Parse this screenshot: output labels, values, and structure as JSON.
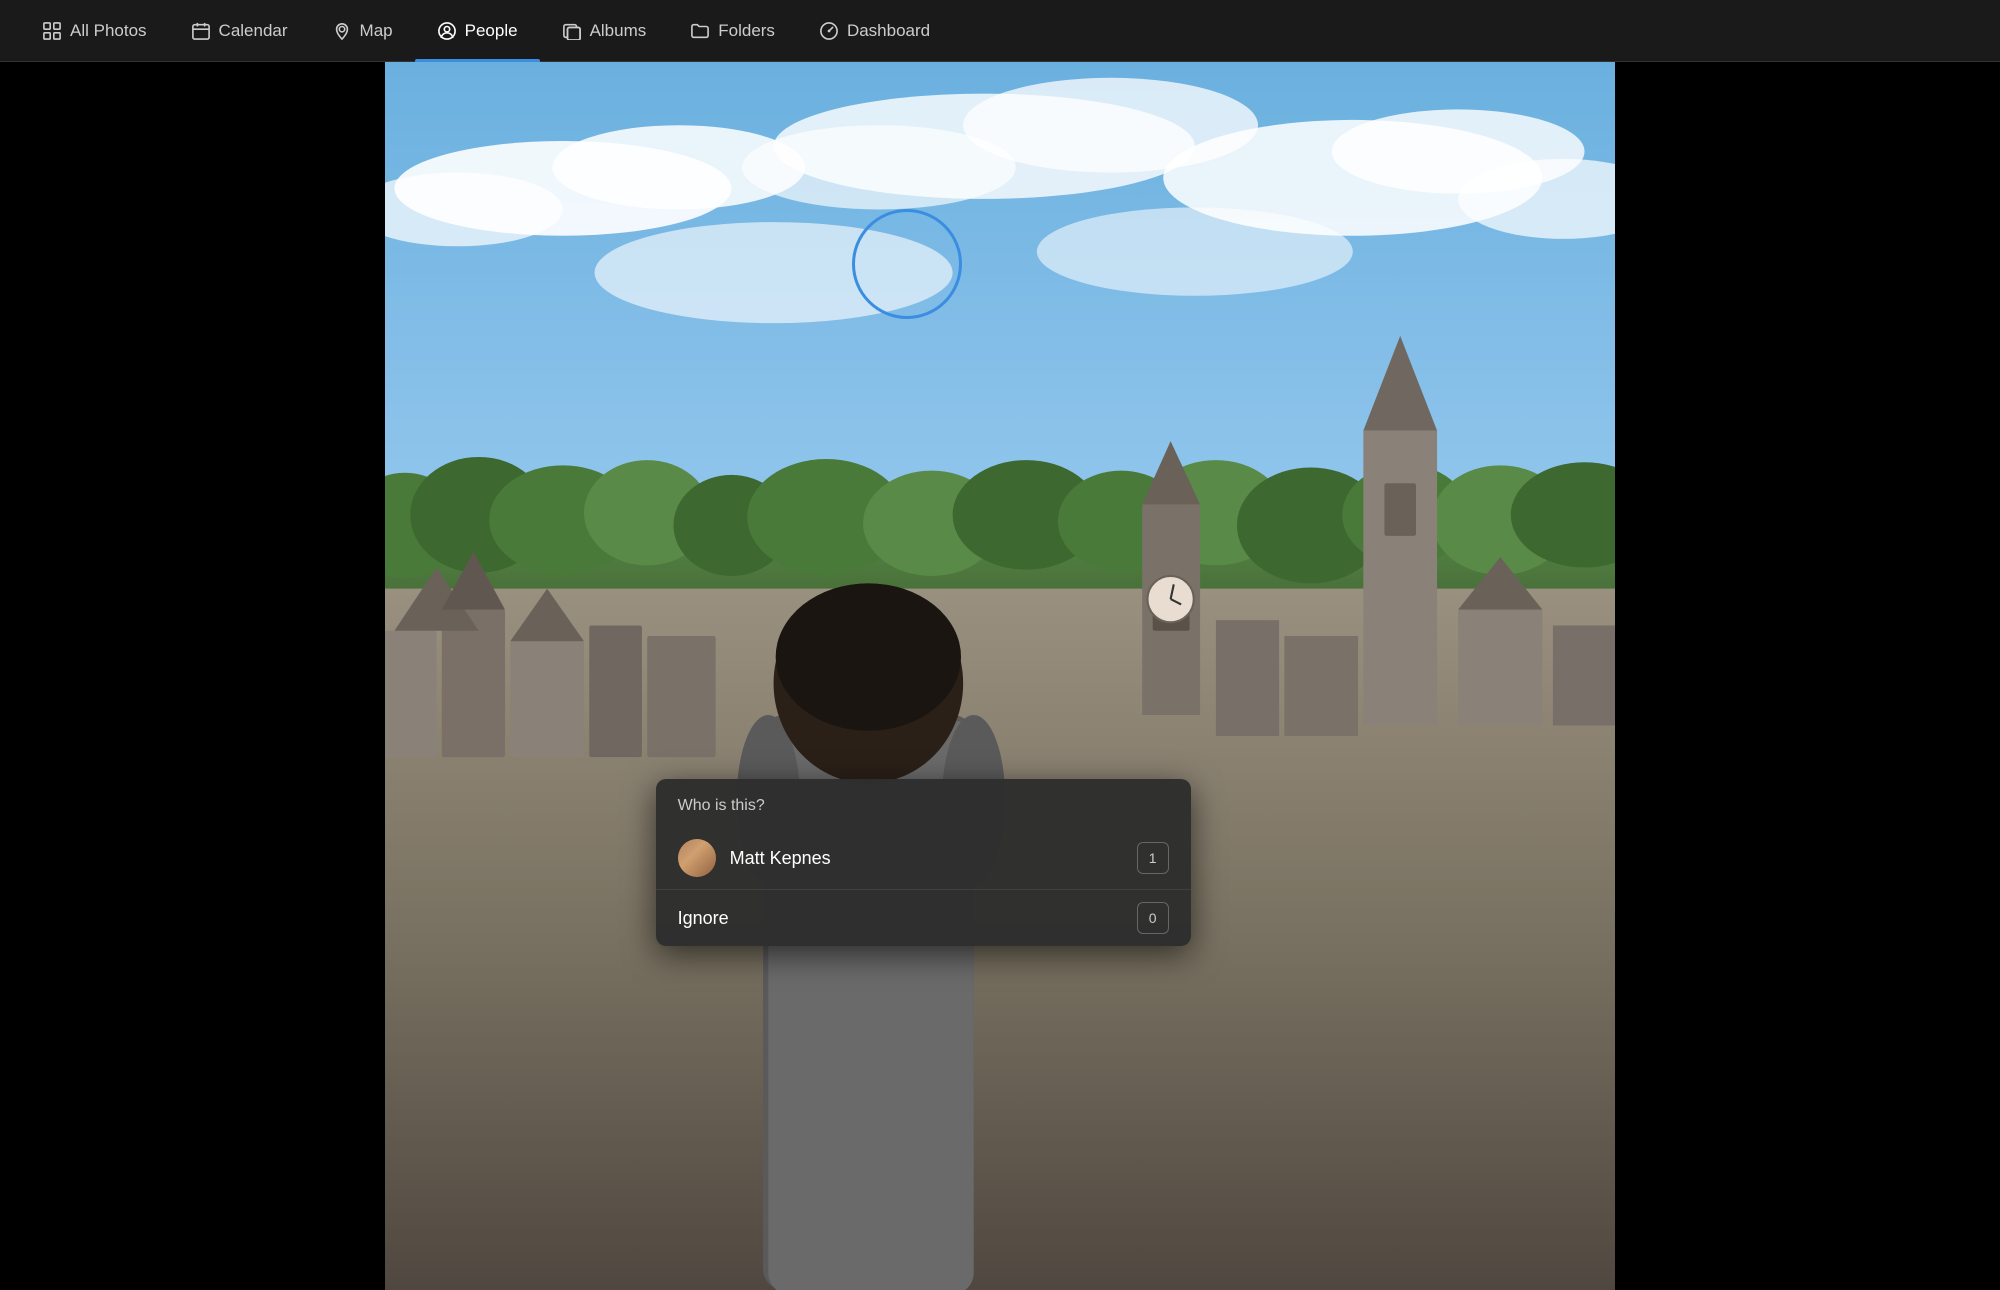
{
  "nav": {
    "items": [
      {
        "id": "all-photos",
        "label": "All Photos",
        "icon": "grid",
        "active": false
      },
      {
        "id": "calendar",
        "label": "Calendar",
        "icon": "calendar",
        "active": false
      },
      {
        "id": "map",
        "label": "Map",
        "icon": "map-pin",
        "active": false
      },
      {
        "id": "people",
        "label": "People",
        "icon": "person-circle",
        "active": true
      },
      {
        "id": "albums",
        "label": "Albums",
        "icon": "album",
        "active": false
      },
      {
        "id": "folders",
        "label": "Folders",
        "icon": "folder",
        "active": false
      },
      {
        "id": "dashboard",
        "label": "Dashboard",
        "icon": "dashboard",
        "active": false
      }
    ]
  },
  "popup": {
    "header": "Who is this?",
    "people": [
      {
        "id": "matt-kepnes",
        "name": "Matt Kepnes",
        "count": 1
      }
    ],
    "ignore": {
      "label": "Ignore",
      "count": 0
    }
  },
  "colors": {
    "nav_bg": "#1a1a1a",
    "active_indicator": "#3b8de0",
    "popup_bg": "#2d2d2d",
    "face_circle": "#3b8de0"
  }
}
